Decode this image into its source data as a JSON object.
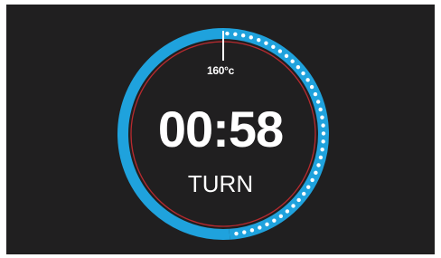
{
  "timer": {
    "temperature": "160°c",
    "time_remaining": "00:58",
    "status": "TURN",
    "progress_elapsed_fraction": 0.51
  },
  "colors": {
    "background": "#201f20",
    "progress_ring": "#1fa2dd",
    "inner_ring": "#b72a2f",
    "dots": "#ffffff",
    "text": "#ffffff"
  },
  "icons": {
    "temperature_marker": "tick-marker-icon"
  }
}
